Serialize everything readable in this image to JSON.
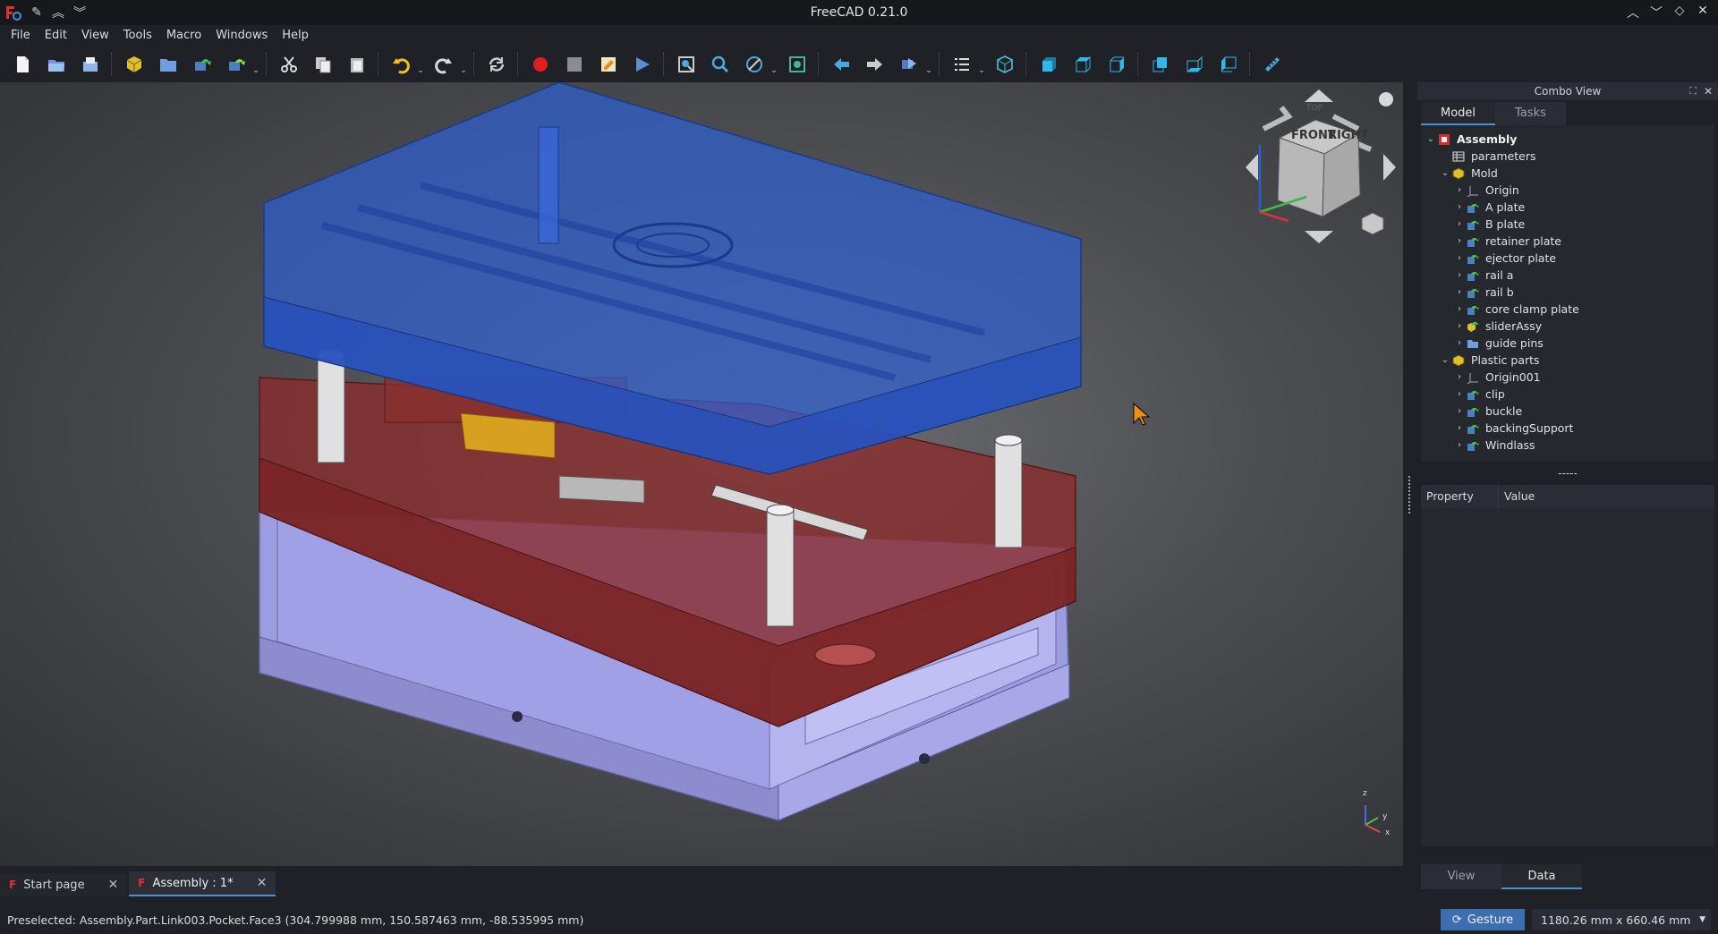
{
  "window": {
    "title": "FreeCAD 0.21.0"
  },
  "menu": [
    "File",
    "Edit",
    "View",
    "Tools",
    "Macro",
    "Windows",
    "Help"
  ],
  "combo_view": {
    "title": "Combo View",
    "tabs": [
      "Model",
      "Tasks"
    ],
    "active_tab": "Model",
    "tree": [
      {
        "label": "Assembly",
        "level": 0,
        "expand": "open",
        "icon": "assembly-icon",
        "bold": true
      },
      {
        "label": "parameters",
        "level": 1,
        "expand": "none",
        "icon": "spreadsheet-icon"
      },
      {
        "label": "Mold",
        "level": 1,
        "expand": "open",
        "icon": "part-icon"
      },
      {
        "label": "Origin",
        "level": 2,
        "expand": "closed",
        "icon": "origin-icon"
      },
      {
        "label": "A plate",
        "level": 2,
        "expand": "closed",
        "icon": "link-icon"
      },
      {
        "label": "B plate",
        "level": 2,
        "expand": "closed",
        "icon": "link-icon"
      },
      {
        "label": "retainer plate",
        "level": 2,
        "expand": "closed",
        "icon": "link-icon"
      },
      {
        "label": "ejector plate",
        "level": 2,
        "expand": "closed",
        "icon": "link-icon"
      },
      {
        "label": "rail a",
        "level": 2,
        "expand": "closed",
        "icon": "link-icon"
      },
      {
        "label": "rail b",
        "level": 2,
        "expand": "closed",
        "icon": "link-icon"
      },
      {
        "label": "core clamp plate",
        "level": 2,
        "expand": "closed",
        "icon": "link-icon"
      },
      {
        "label": "sliderAssy",
        "level": 2,
        "expand": "closed",
        "icon": "part-link-icon"
      },
      {
        "label": "guide pins",
        "level": 2,
        "expand": "closed",
        "icon": "folder-icon"
      },
      {
        "label": "Plastic parts",
        "level": 1,
        "expand": "open",
        "icon": "part-icon"
      },
      {
        "label": "Origin001",
        "level": 2,
        "expand": "closed",
        "icon": "origin-icon"
      },
      {
        "label": "clip",
        "level": 2,
        "expand": "closed",
        "icon": "link-icon"
      },
      {
        "label": "buckle",
        "level": 2,
        "expand": "closed",
        "icon": "link-icon"
      },
      {
        "label": "backingSupport",
        "level": 2,
        "expand": "closed",
        "icon": "link-icon"
      },
      {
        "label": "Windlass",
        "level": 2,
        "expand": "closed",
        "icon": "link-icon"
      }
    ],
    "separator": "-----",
    "property_headers": {
      "property": "Property",
      "value": "Value"
    },
    "bottom_tabs": [
      "View",
      "Data"
    ],
    "active_bottom_tab": "Data"
  },
  "nav_cube": {
    "front": "FRONT",
    "right": "RIGHT",
    "top": "TOP"
  },
  "axis_labels": {
    "z": "z",
    "y": "y",
    "x": "x"
  },
  "doc_tabs": [
    {
      "label": "Start page",
      "active": false
    },
    {
      "label": "Assembly : 1*",
      "active": true
    }
  ],
  "status": {
    "message": "Preselected: Assembly.Part.Link003.Pocket.Face3 (304.799988 mm, 150.587463 mm, -88.535995 mm)",
    "nav_style": "Gesture",
    "dimensions": "1180.26 mm x 660.46 mm"
  },
  "colors": {
    "accent": "#4a8fd8",
    "plate_blue": "#2f5fd0",
    "plate_red": "#8a2a2a",
    "plate_lavender": "#9c9ce0",
    "slider_gold": "#d8a020",
    "record_red": "#e02020"
  }
}
